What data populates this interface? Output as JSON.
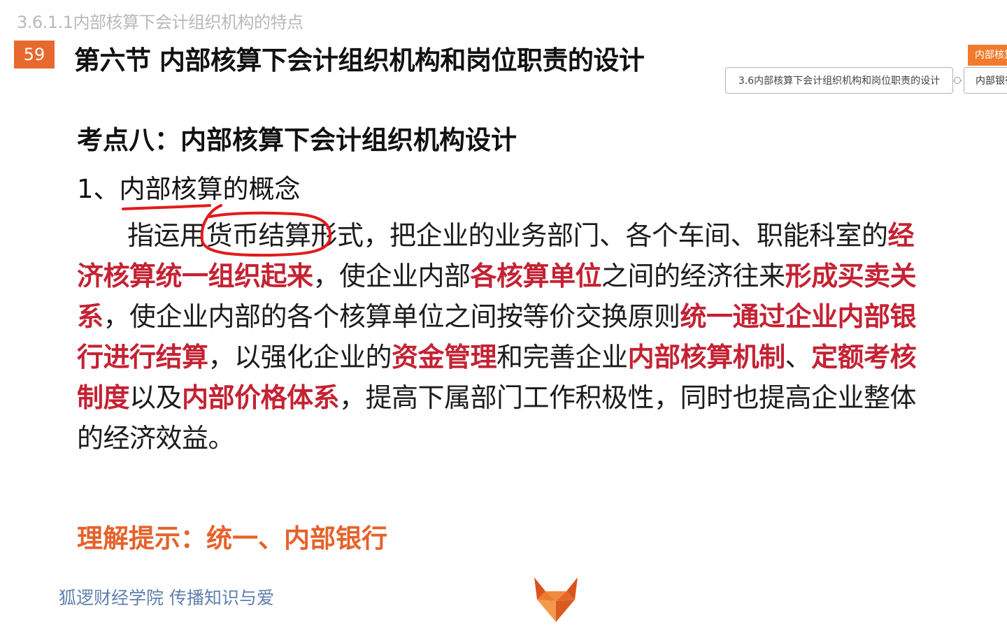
{
  "header": {
    "breadcrumb": "3.6.1.1内部核算下会计组织机构的特点",
    "page_number": "59",
    "section_title": "第六节 内部核算下会计组织机构和岗位职责的设计"
  },
  "mindmap": {
    "node_label": "3.6内部核算下会计组织机构和岗位职责的设计",
    "child_label": "内部银行",
    "orange_label": "内部核算"
  },
  "content": {
    "kp_title": "考点八：内部核算下会计组织机构设计",
    "concept_title": "1、内部核算的概念",
    "paragraph": [
      {
        "text": "指运用货币结算形式，把企业的业务部门、各个车间、职能科室的",
        "hl": false
      },
      {
        "text": "经济核算统一组织起来",
        "hl": true
      },
      {
        "text": "，使企业内部",
        "hl": false
      },
      {
        "text": "各核算单位",
        "hl": true
      },
      {
        "text": "之间的经济往来",
        "hl": false
      },
      {
        "text": "形成买卖关系",
        "hl": true
      },
      {
        "text": "，使企业内部的各个核算单位之间按等价交换原则",
        "hl": false
      },
      {
        "text": "统一通过企业内部银行进行结算",
        "hl": true
      },
      {
        "text": "，以强化企业的",
        "hl": false
      },
      {
        "text": "资金管理",
        "hl": true
      },
      {
        "text": "和完善企业",
        "hl": false
      },
      {
        "text": "内部核算机制",
        "hl": true
      },
      {
        "text": "、",
        "hl": false
      },
      {
        "text": "定额考核制度",
        "hl": true
      },
      {
        "text": "以及",
        "hl": false
      },
      {
        "text": "内部价格体系",
        "hl": true
      },
      {
        "text": "，提高下属部门工作积极性，同时也提高企业整体的经济效益。",
        "hl": false
      }
    ],
    "hint": "理解提示：统一、内部银行"
  },
  "footer": {
    "slogan": "狐逻财经学院 传播知识与爱"
  },
  "colors": {
    "accent_orange": "#e8692f",
    "highlight_red": "#c42233",
    "hint_orange": "#e5622a",
    "annotation_red": "#e21b1b",
    "slogan_blue": "#5f7fae"
  }
}
